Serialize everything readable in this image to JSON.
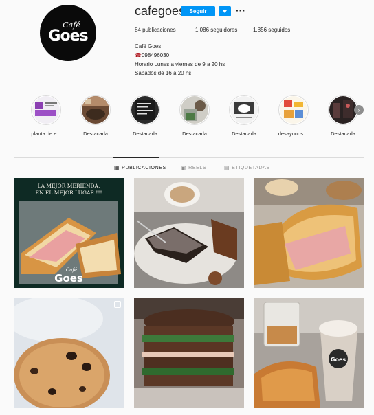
{
  "profile": {
    "username": "cafegoes",
    "follow_label": "Seguir",
    "avatar_text_top": "Café",
    "avatar_text_main": "Goes",
    "stats": {
      "posts": "84 publicaciones",
      "followers": "1,086 seguidores",
      "following": "1,856 seguidos"
    },
    "bio": {
      "name": "Café Goes",
      "phone": "098496030",
      "line1": "Horario Lunes a viernes de 9 a 20 hs",
      "line2": "Sábados de 16 a 20 hs"
    }
  },
  "highlights": [
    {
      "label": "planta de e..."
    },
    {
      "label": "Destacada"
    },
    {
      "label": "Destacada"
    },
    {
      "label": "Destacada"
    },
    {
      "label": "Destacada"
    },
    {
      "label": "desayunos ..."
    },
    {
      "label": "Destacada"
    }
  ],
  "tabs": {
    "posts": "PUBLICACIONES",
    "reels": "REELS",
    "tagged": "ETIQUETADAS"
  },
  "posts": [
    {
      "overlay_line1": "LA MEJOR MERIENDA,",
      "overlay_line2": "EN EL MEJOR LUGAR !!!",
      "logo_top": "Café",
      "logo_main": "Goes"
    },
    {},
    {},
    {
      "is_reel": true
    },
    {},
    {
      "cup_logo": "Goes"
    }
  ],
  "colors": {
    "accent": "#0095f6",
    "text": "#262626",
    "muted": "#8e8e8e",
    "border": "#dbdbdb"
  }
}
